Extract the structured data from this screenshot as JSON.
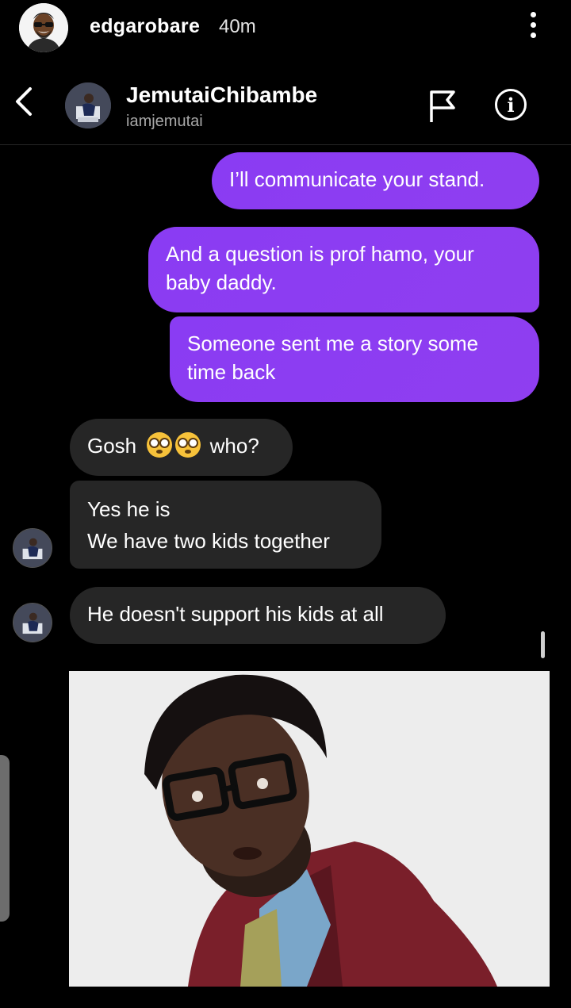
{
  "story": {
    "username": "edgarobare",
    "time": "40m"
  },
  "chat": {
    "contact_name": "JemutaiChibambe",
    "contact_handle": "iamjemutai"
  },
  "messages": {
    "m1": "I’ll communicate your stand.",
    "m2a": "And a question is prof hamo, your",
    "m2b": "baby daddy.",
    "m3a": "Someone sent me a story some",
    "m3b": "time back",
    "r1_pre": "Gosh",
    "r1_post": "who?",
    "r2a": "Yes he is",
    "r2b": "We have two kids together",
    "r3": "He doesn't support his kids at all"
  },
  "icons": [
    "more-icon",
    "back-icon",
    "flag-icon",
    "info-icon",
    "flushed-face-emoji"
  ],
  "colors": {
    "sent_bubble": "#8b3cf3",
    "received_bubble": "#262626",
    "background": "#000000"
  }
}
